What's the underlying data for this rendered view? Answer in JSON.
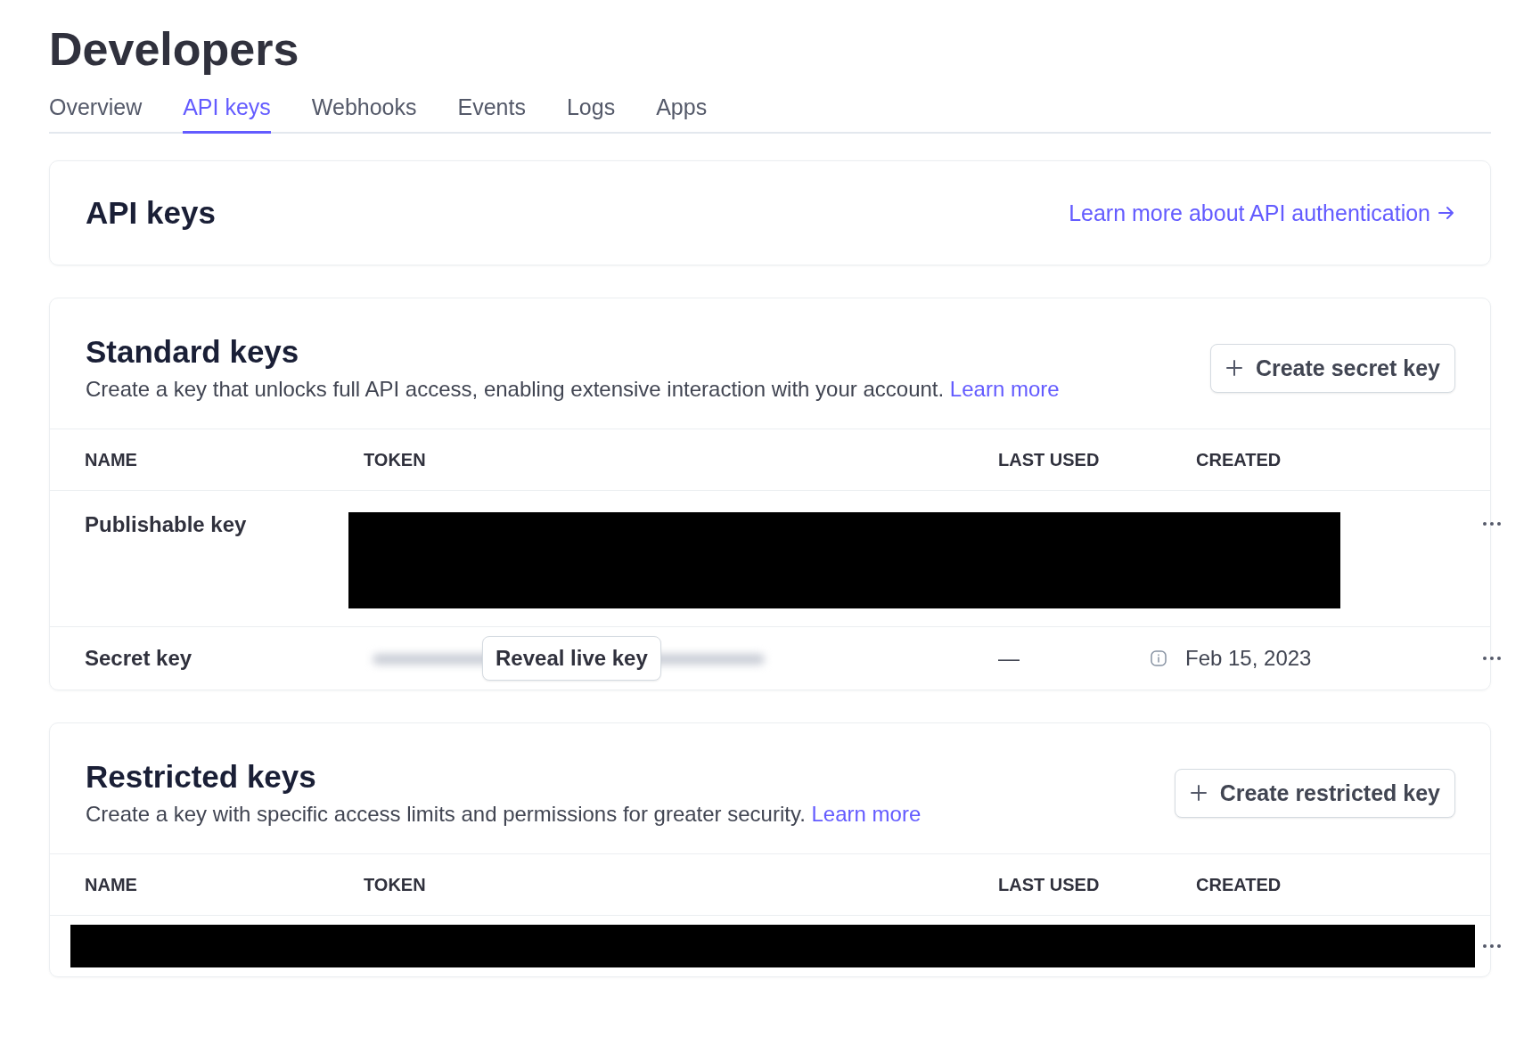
{
  "page_title": "Developers",
  "tabs": [
    {
      "label": "Overview",
      "selected": false
    },
    {
      "label": "API keys",
      "selected": true
    },
    {
      "label": "Webhooks",
      "selected": false
    },
    {
      "label": "Events",
      "selected": false
    },
    {
      "label": "Logs",
      "selected": false
    },
    {
      "label": "Apps",
      "selected": false
    }
  ],
  "header_card": {
    "title": "API keys",
    "link": "Learn more about API authentication"
  },
  "sections": [
    {
      "title": "Standard keys",
      "description": "Create a key that unlocks full API access, enabling extensive interaction with your account.",
      "link": "Learn more",
      "button": "Create secret key",
      "columns": [
        "NAME",
        "TOKEN",
        "LAST USED",
        "CREATED"
      ],
      "rows": [
        {
          "kind": "redacted",
          "name": "Publishable key"
        },
        {
          "kind": "key",
          "name": "Secret key",
          "reveal_button": "Reveal live key",
          "last_used": "—",
          "created": "Feb 15, 2023"
        }
      ]
    },
    {
      "title": "Restricted keys",
      "description": "Create a key with specific access limits and permissions for greater security.",
      "link": "Learn more",
      "button": "Create restricted key",
      "columns": [
        "NAME",
        "TOKEN",
        "LAST USED",
        "CREATED"
      ],
      "rows": [
        {
          "kind": "redacted_full"
        }
      ]
    }
  ]
}
